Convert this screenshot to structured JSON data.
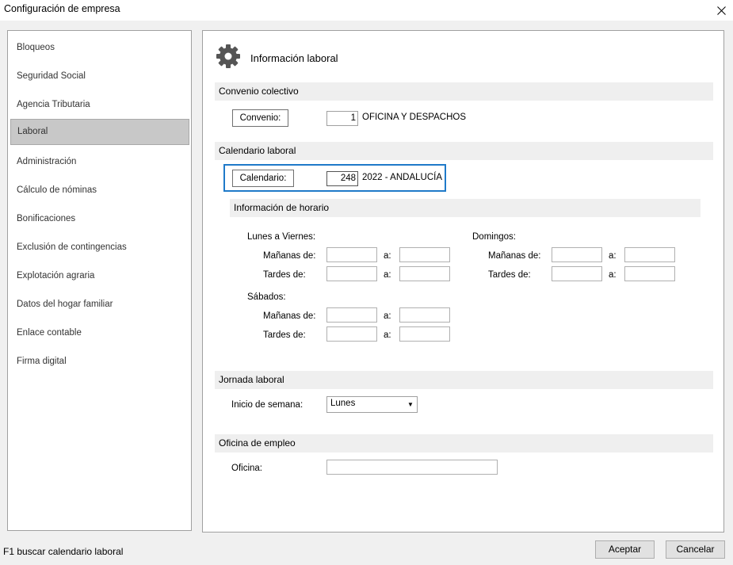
{
  "window": {
    "title": "Configuración de empresa"
  },
  "sidebar": {
    "items": [
      {
        "label": "Bloqueos"
      },
      {
        "label": "Seguridad Social"
      },
      {
        "label": "Agencia Tributaria"
      },
      {
        "label": "Laboral",
        "selected": true
      },
      {
        "label": "Administración"
      },
      {
        "label": "Cálculo de nóminas"
      },
      {
        "label": "Bonificaciones"
      },
      {
        "label": "Exclusión de contingencias"
      },
      {
        "label": "Explotación agraria"
      },
      {
        "label": "Datos del hogar familiar"
      },
      {
        "label": "Enlace contable"
      },
      {
        "label": "Firma digital"
      }
    ]
  },
  "main": {
    "title": "Información laboral",
    "icon": "gear-icon",
    "convenio": {
      "section_title": "Convenio colectivo",
      "button_label": "Convenio:",
      "code": "1",
      "description": "OFICINA Y DESPACHOS"
    },
    "calendario": {
      "section_title": "Calendario laboral",
      "button_label": "Calendario:",
      "code": "248",
      "description": "2022 - ANDALUCÍA",
      "highlight_color": "#1f7ac9"
    },
    "horario": {
      "section_title": "Información de horario",
      "weekdays_label": "Lunes a Viernes:",
      "sundays_label": "Domingos:",
      "saturdays_label": "Sábados:",
      "mornings_label": "Mañanas de:",
      "afternoons_label": "Tardes de:",
      "to_label": "a:"
    },
    "jornada": {
      "section_title": "Jornada laboral",
      "week_start_label": "Inicio de semana:",
      "week_start_value": "Lunes"
    },
    "oficina": {
      "section_title": "Oficina de empleo",
      "office_label": "Oficina:",
      "office_value": ""
    }
  },
  "footer": {
    "status": "F1 buscar calendario laboral",
    "accept_label": "Aceptar",
    "cancel_label": "Cancelar"
  }
}
